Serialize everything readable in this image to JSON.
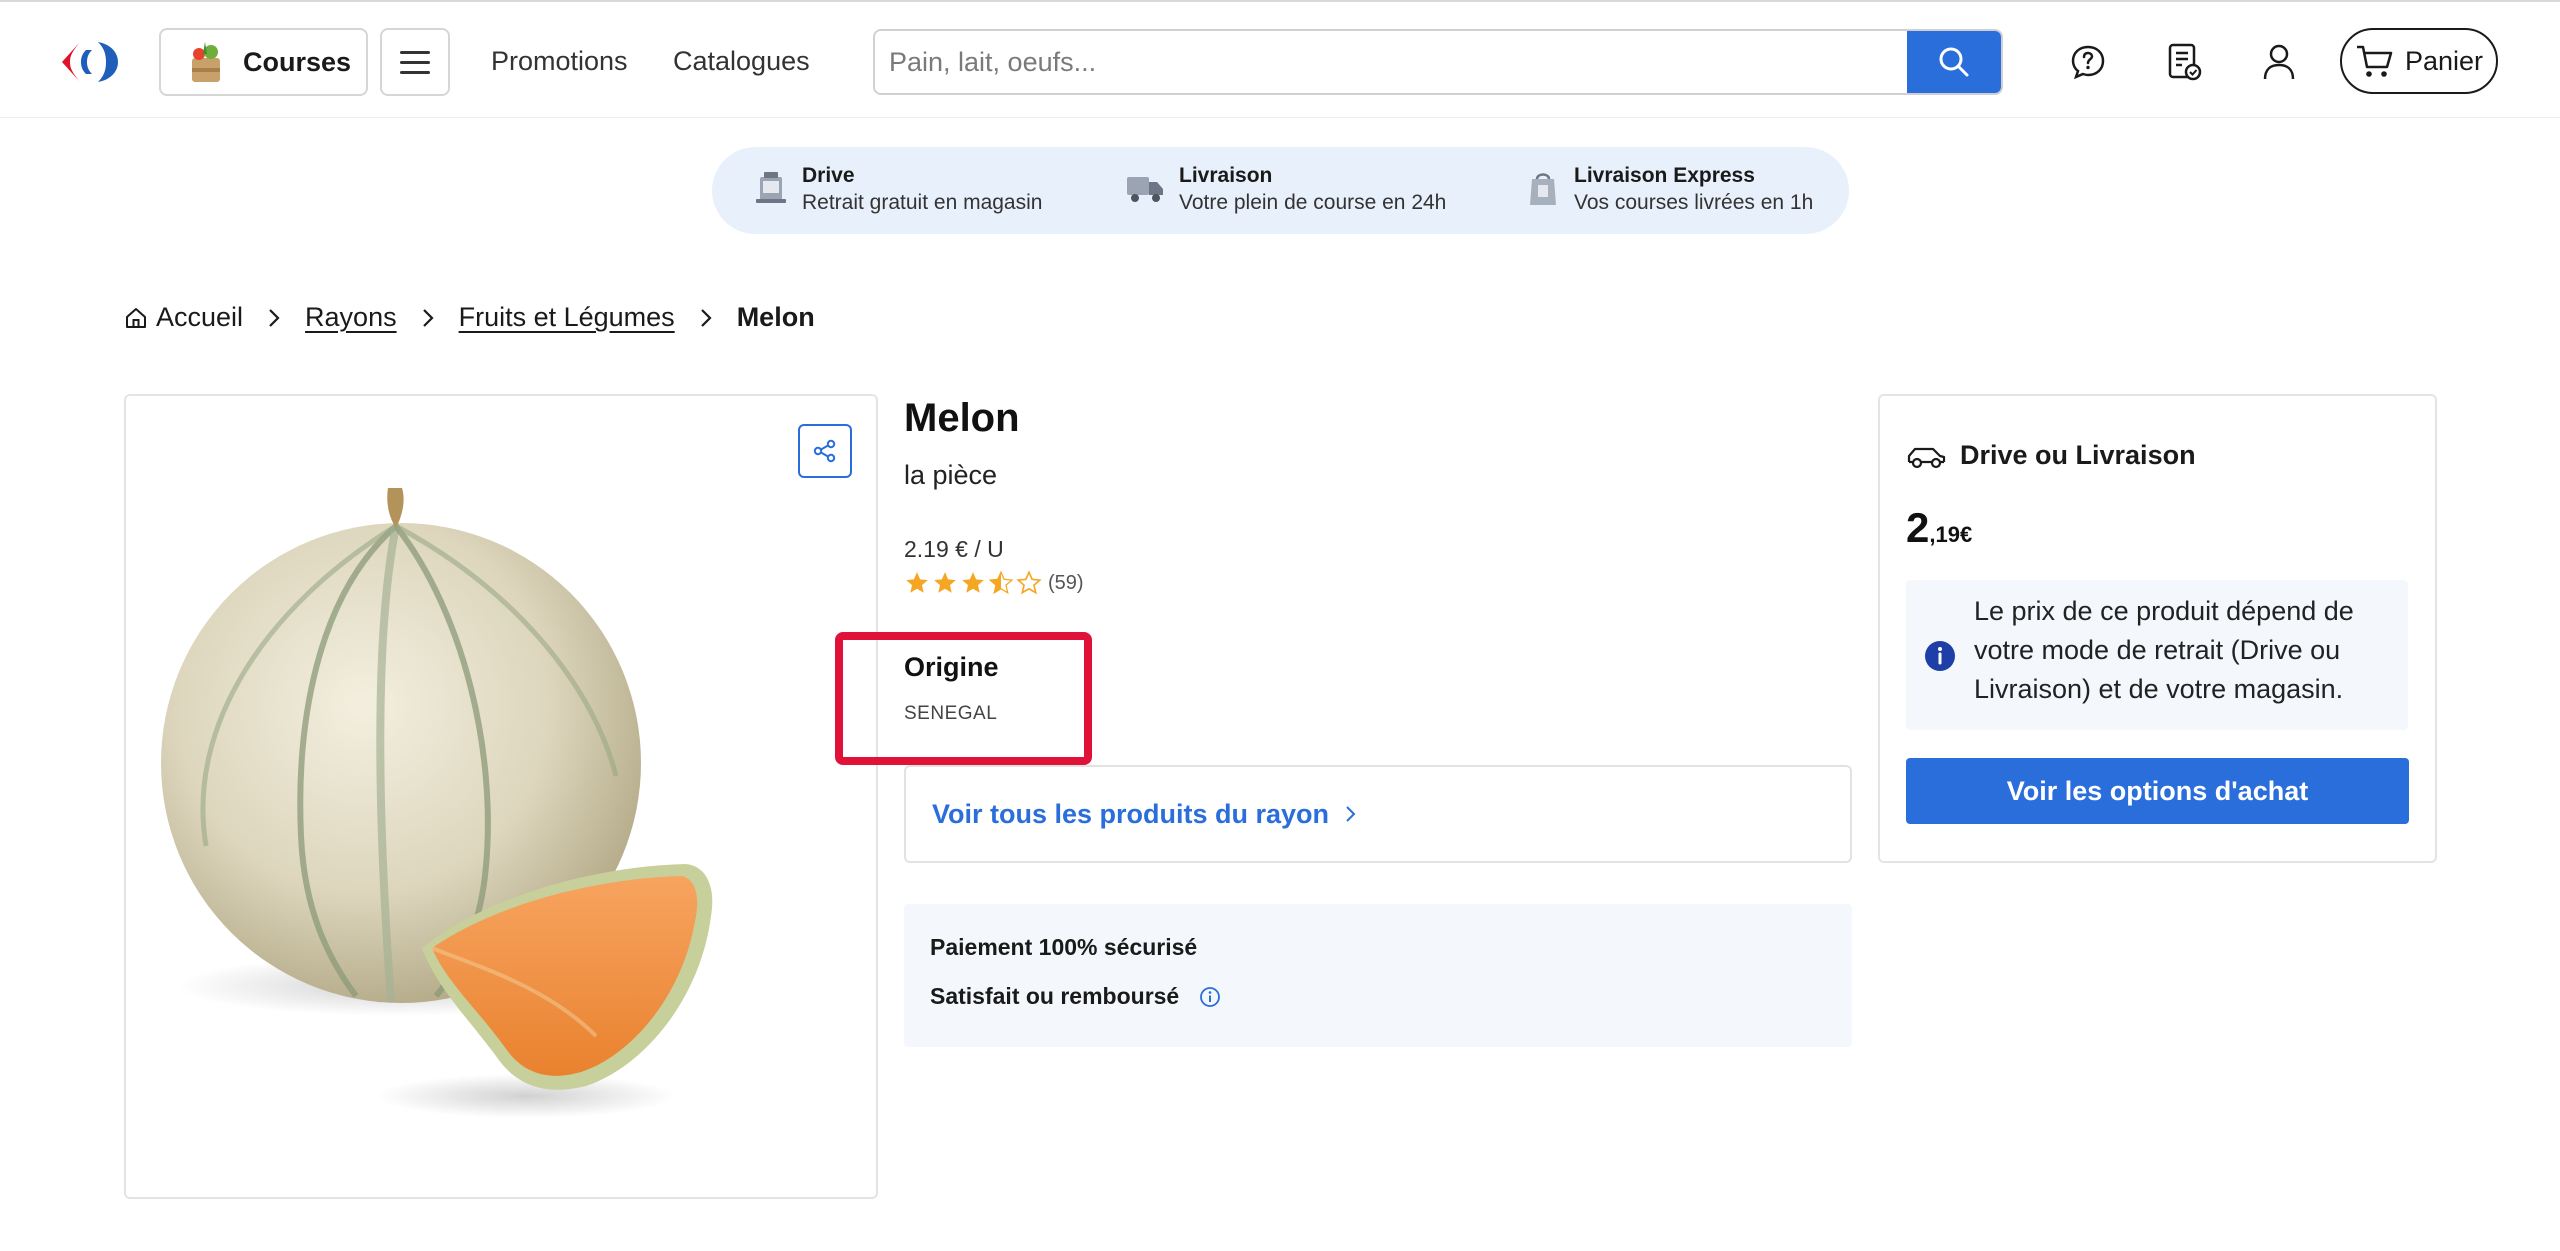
{
  "header": {
    "logo": "carrefour-logo",
    "courses_label": "Courses",
    "nav": {
      "promotions": "Promotions",
      "catalogues": "Catalogues"
    },
    "search": {
      "placeholder": "Pain, lait, oeufs...",
      "value": ""
    },
    "cart_label": "Panier",
    "icons": [
      "help-icon",
      "shopping-list-icon",
      "account-icon",
      "cart-icon"
    ]
  },
  "banner": {
    "items": [
      {
        "title": "Drive",
        "subtitle": "Retrait gratuit en magasin",
        "icon": "drive-icon"
      },
      {
        "title": "Livraison",
        "subtitle": "Votre plein de course en 24h",
        "icon": "truck-icon"
      },
      {
        "title": "Livraison Express",
        "subtitle": "Vos courses livrées en 1h",
        "icon": "express-bag-icon"
      }
    ]
  },
  "breadcrumb": {
    "home": "Accueil",
    "rayons": "Rayons",
    "category": "Fruits et Légumes",
    "current": "Melon"
  },
  "product": {
    "title": "Melon",
    "unit": "la pièce",
    "price_per_unit": "2.19 € / U",
    "rating": {
      "value": 3.5,
      "max": 5,
      "count_text": "(59)"
    },
    "origin_label": "Origine",
    "origin_value": "SENEGAL",
    "rayon_link": "Voir tous les produits du rayon",
    "assurance": {
      "payment": "Paiement 100% sécurisé",
      "satisfaction": "Satisfait ou remboursé"
    }
  },
  "purchase": {
    "mode_title": "Drive ou Livraison",
    "price_int": "2",
    "price_dec": ",19€",
    "info_text": "Le prix de ce produit dépend de votre mode de retrait (Drive ou Livraison) et de votre magasin.",
    "cta_label": "Voir les options d'achat"
  },
  "colors": {
    "accent_blue": "#2a6edb",
    "highlight_red": "#e0123a",
    "banner_bg": "#e8f0fb",
    "star": "#f5a623"
  }
}
